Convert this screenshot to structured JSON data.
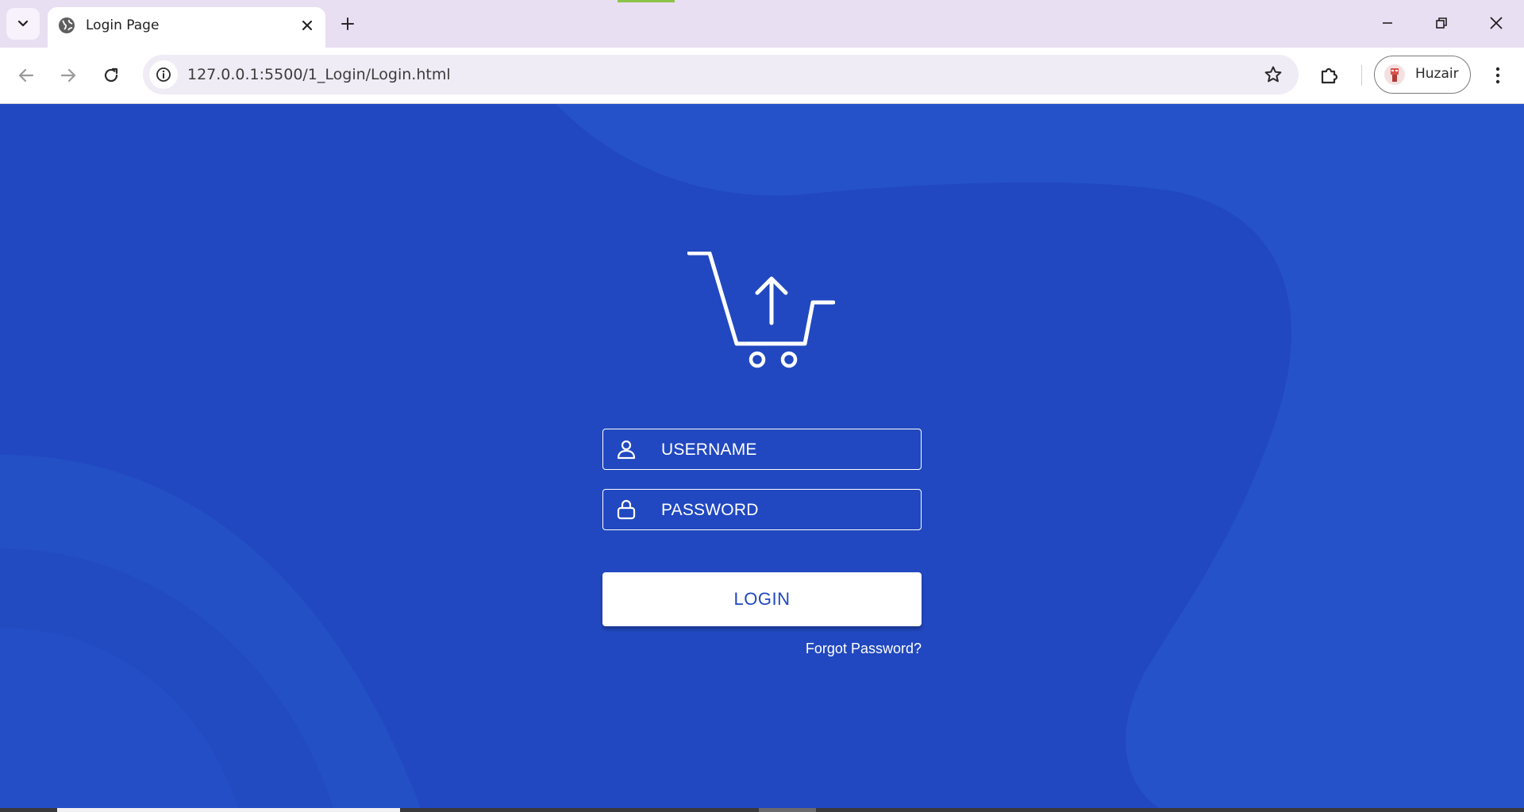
{
  "browser": {
    "tab": {
      "title": "Login Page",
      "favicon": "globe-icon"
    },
    "url": "127.0.0.1:5500/1_Login/Login.html",
    "profile": {
      "name": "Huzair"
    },
    "icons": {
      "tab_search": "chevron-down-icon",
      "tab_close": "close-icon",
      "new_tab": "plus-icon",
      "minimize": "minimize-icon",
      "restore": "restore-icon",
      "close_window": "close-icon",
      "back": "arrow-left-icon",
      "forward": "arrow-right-icon",
      "reload": "reload-icon",
      "site_info": "info-icon",
      "bookmark": "star-icon",
      "extensions": "puzzle-icon",
      "menu": "kebab-menu-icon"
    }
  },
  "login": {
    "logo": "cart-upload-icon",
    "username_label": "USERNAME",
    "username_icon": "user-icon",
    "password_label": "PASSWORD",
    "password_icon": "lock-icon",
    "login_button": "LOGIN",
    "forgot_password": "Forgot Password?"
  },
  "colors": {
    "background": "#2148c0",
    "background_shape": "#2552c9",
    "button_text": "#2148c0",
    "field_border": "#ffffff",
    "tabbar": "#e8dff2"
  }
}
